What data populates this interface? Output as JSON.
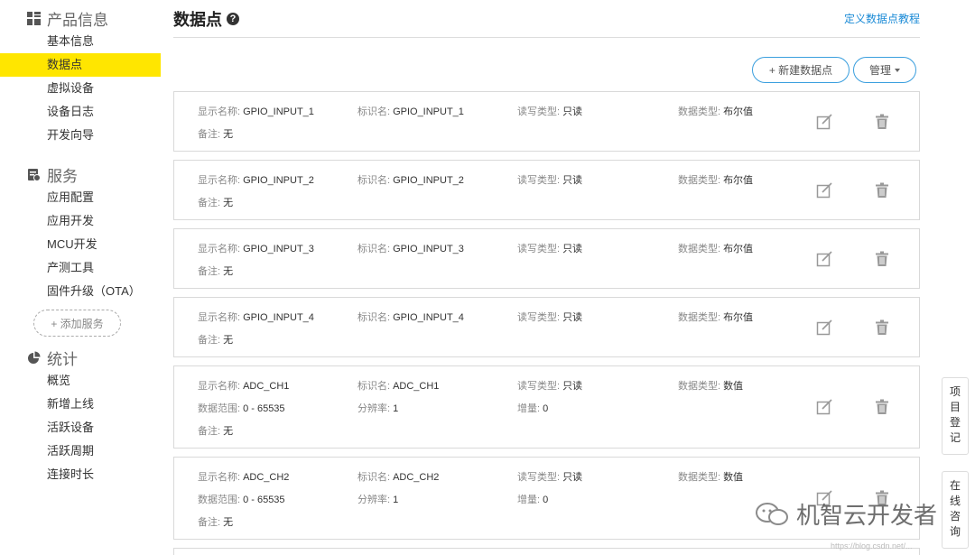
{
  "sidebar": {
    "groups": [
      {
        "title": "产品信息",
        "icon": "grid-icon",
        "items": [
          "基本信息",
          "数据点",
          "虚拟设备",
          "设备日志",
          "开发向导"
        ]
      },
      {
        "title": "服务",
        "icon": "service-icon",
        "items": [
          "应用配置",
          "应用开发",
          "MCU开发",
          "产测工具",
          "固件升级（OTA）"
        ]
      },
      {
        "title": "统计",
        "icon": "pie-chart-icon",
        "items": [
          "概览",
          "新增上线",
          "活跃设备",
          "活跃周期",
          "连接时长"
        ]
      }
    ],
    "active_item": "数据点",
    "add_service": "+ 添加服务"
  },
  "header": {
    "title": "数据点",
    "tutorial_link": "定义数据点教程"
  },
  "actions": {
    "new_label": "+ 新建数据点",
    "manage_label": "管理"
  },
  "labels": {
    "display_name": "显示名称:",
    "identifier": "标识名:",
    "rw_type": "读写类型:",
    "data_type": "数据类型:",
    "remark": "备注:",
    "range": "数据范围:",
    "resolution": "分辨率:",
    "increment": "增量:"
  },
  "datapoints": [
    {
      "display_name": "GPIO_INPUT_1",
      "identifier": "GPIO_INPUT_1",
      "rw": "只读",
      "dtype": "布尔值",
      "remark": "无"
    },
    {
      "display_name": "GPIO_INPUT_2",
      "identifier": "GPIO_INPUT_2",
      "rw": "只读",
      "dtype": "布尔值",
      "remark": "无"
    },
    {
      "display_name": "GPIO_INPUT_3",
      "identifier": "GPIO_INPUT_3",
      "rw": "只读",
      "dtype": "布尔值",
      "remark": "无"
    },
    {
      "display_name": "GPIO_INPUT_4",
      "identifier": "GPIO_INPUT_4",
      "rw": "只读",
      "dtype": "布尔值",
      "remark": "无"
    },
    {
      "display_name": "ADC_CH1",
      "identifier": "ADC_CH1",
      "rw": "只读",
      "dtype": "数值",
      "range": "0 - 65535",
      "resolution": "1",
      "increment": "0",
      "remark": "无"
    },
    {
      "display_name": "ADC_CH2",
      "identifier": "ADC_CH2",
      "rw": "只读",
      "dtype": "数值",
      "range": "0 - 65535",
      "resolution": "1",
      "increment": "0",
      "remark": "无"
    }
  ],
  "float_tabs": [
    "项目登记",
    "在线咨询"
  ],
  "watermark": {
    "text": "机智云开发者",
    "url": "https://blog.csdn.net/..."
  }
}
